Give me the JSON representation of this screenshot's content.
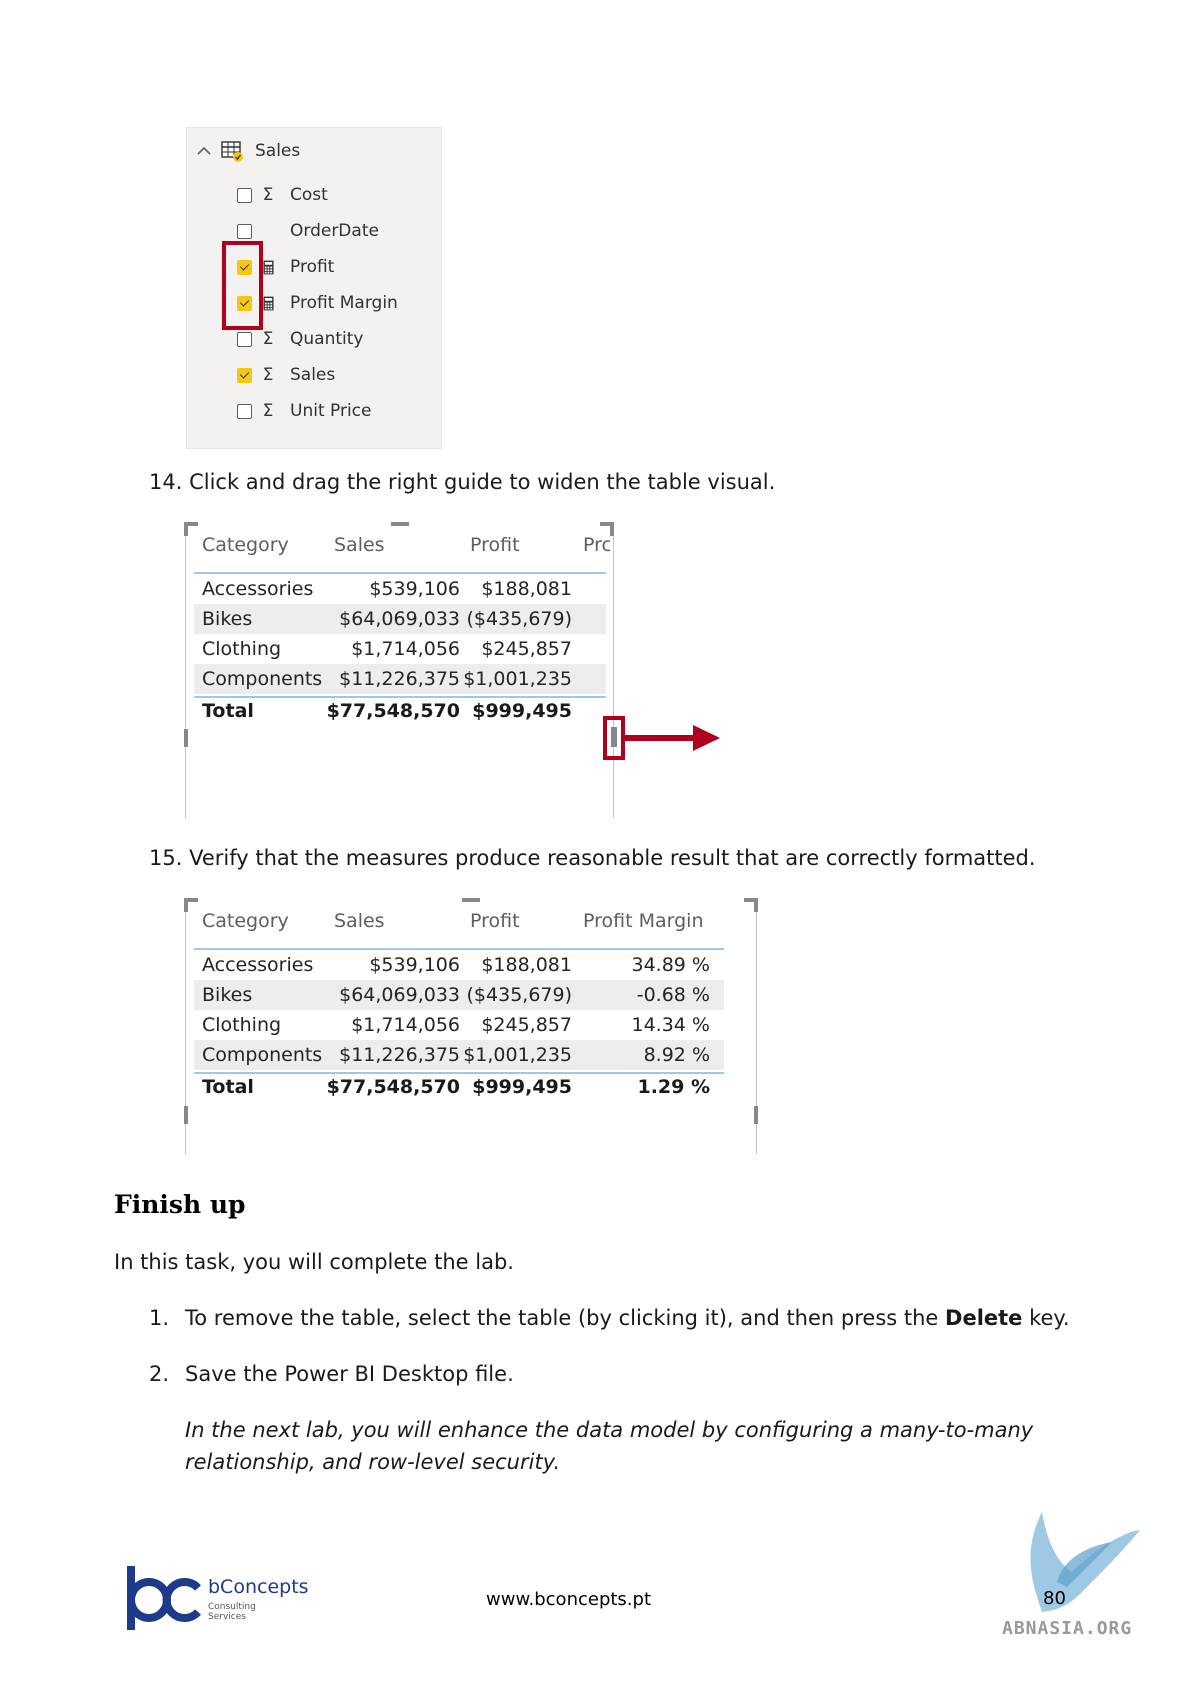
{
  "fields_pane": {
    "table_name": "Sales",
    "fields": [
      {
        "label": "Cost",
        "checked": false,
        "icon": "sigma-icon"
      },
      {
        "label": "OrderDate",
        "checked": false,
        "icon": "none"
      },
      {
        "label": "Profit",
        "checked": true,
        "icon": "calculator-icon"
      },
      {
        "label": "Profit Margin",
        "checked": true,
        "icon": "calculator-icon"
      },
      {
        "label": "Quantity",
        "checked": false,
        "icon": "sigma-icon"
      },
      {
        "label": "Sales",
        "checked": true,
        "icon": "sigma-icon"
      },
      {
        "label": "Unit Price",
        "checked": false,
        "icon": "sigma-icon"
      }
    ],
    "accent_color": "#f2c811",
    "highlight_color": "#b00020"
  },
  "step14": {
    "number": "14.",
    "text": "Click and drag the right guide to widen the table visual."
  },
  "table1": {
    "headers": [
      "Category",
      "Sales",
      "Profit",
      "Prc"
    ],
    "rows": [
      [
        "Accessories",
        "$539,106",
        "$188,081"
      ],
      [
        "Bikes",
        "$64,069,033",
        "($435,679)"
      ],
      [
        "Clothing",
        "$1,714,056",
        "$245,857"
      ],
      [
        "Components",
        "$11,226,375",
        "$1,001,235"
      ]
    ],
    "total": [
      "Total",
      "$77,548,570",
      "$999,495"
    ]
  },
  "step15": {
    "number": "15.",
    "text": "Verify that the measures produce reasonable result that are correctly formatted."
  },
  "table2": {
    "headers": [
      "Category",
      "Sales",
      "Profit",
      "Profit Margin"
    ],
    "rows": [
      [
        "Accessories",
        "$539,106",
        "$188,081",
        "34.89 %"
      ],
      [
        "Bikes",
        "$64,069,033",
        "($435,679)",
        "-0.68 %"
      ],
      [
        "Clothing",
        "$1,714,056",
        "$245,857",
        "14.34 %"
      ],
      [
        "Components",
        "$11,226,375",
        "$1,001,235",
        "8.92 %"
      ]
    ],
    "total": [
      "Total",
      "$77,548,570",
      "$999,495",
      "1.29 %"
    ]
  },
  "finish": {
    "heading": "Finish up",
    "intro": "In this task, you will complete the lab.",
    "item1_number": "1.",
    "item1_pre": "To remove the table, select the table (by clicking it), and then press the ",
    "item1_bold": "Delete",
    "item1_post": " key.",
    "item2_number": "2.",
    "item2": "Save the Power BI Desktop file.",
    "note_line1": "In the next lab, you will enhance the data model by configuring a many-to-many",
    "note_line2": "relationship, and row-level security."
  },
  "footer": {
    "brand": "bConcepts",
    "brand_sub1": "Consulting",
    "brand_sub2": "Services",
    "url": "www.bconcepts.pt",
    "page_number": "80",
    "watermark": "ABNASIA.ORG",
    "brand_color": "#1e3a8a"
  }
}
